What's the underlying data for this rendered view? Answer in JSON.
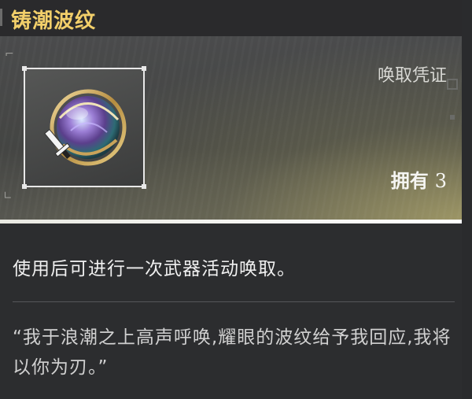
{
  "header": {
    "title": "铸潮波纹"
  },
  "item": {
    "icon": "tidal-orb-icon",
    "exchange_label": "唤取凭证",
    "owned_label": "拥有",
    "owned_count": "3"
  },
  "description": "使用后可进行一次武器活动唤取。",
  "quote": "“我于浪潮之上高声呼唤,耀眼的波纹给予我回应,我将以你为刃。”",
  "colors": {
    "title": "#f2cf6a",
    "accent_glow": "#dacd78",
    "background": "#2c2d2f"
  }
}
